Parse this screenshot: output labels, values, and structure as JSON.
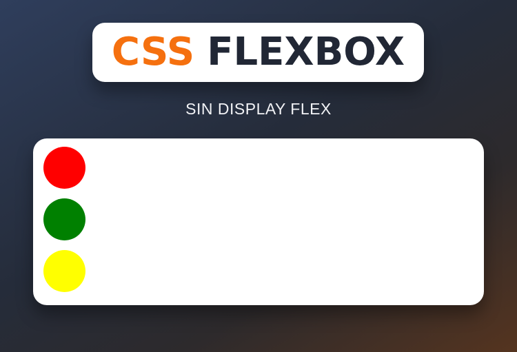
{
  "header": {
    "title_accent": "CSS",
    "title_main": "FLEXBOX",
    "accent_color": "#f5700f",
    "main_color": "#212735"
  },
  "subtitle": "SIN DISPLAY FLEX",
  "container": {
    "items": [
      {
        "name": "red-circle",
        "color": "#ff0000"
      },
      {
        "name": "green-circle",
        "color": "#008000"
      },
      {
        "name": "yellow-circle",
        "color": "#ffff00"
      }
    ]
  }
}
